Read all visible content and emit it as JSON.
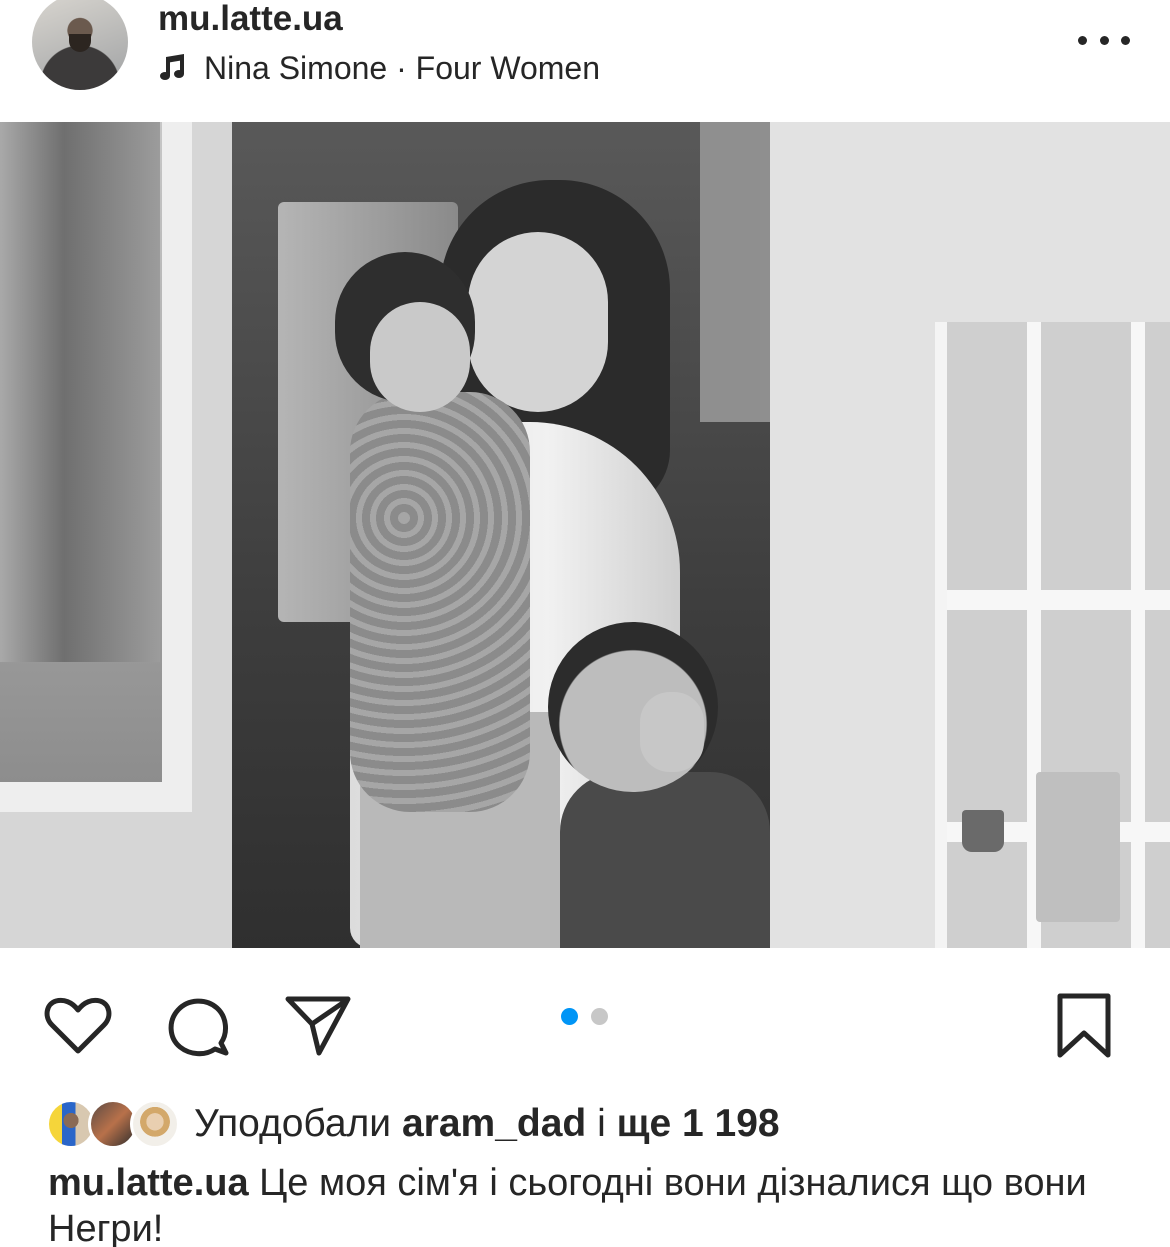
{
  "header": {
    "username": "mu.latte.ua",
    "music_icon": "music-note-icon",
    "music_text": "Nina Simone · Four Women",
    "more_icon": "more-horizontal-icon"
  },
  "photo": {
    "description_icons": [
      "user-tag-icon",
      "speaker-muted-icon"
    ]
  },
  "actions": {
    "like_icon": "heart-icon",
    "comment_icon": "comment-bubble-icon",
    "share_icon": "paper-plane-icon",
    "save_icon": "bookmark-icon",
    "carousel": {
      "count": 2,
      "active_index": 0,
      "active_color": "#0095f6",
      "inactive_color": "#c7c7c7"
    }
  },
  "likes": {
    "prefix": "Уподобали",
    "user": "aram_dad",
    "conjunction": "і",
    "others": "ще 1 198"
  },
  "caption": {
    "username": "mu.latte.ua",
    "text": "Це моя сім'я і сьогодні вони дізналися що вони Негри!"
  }
}
